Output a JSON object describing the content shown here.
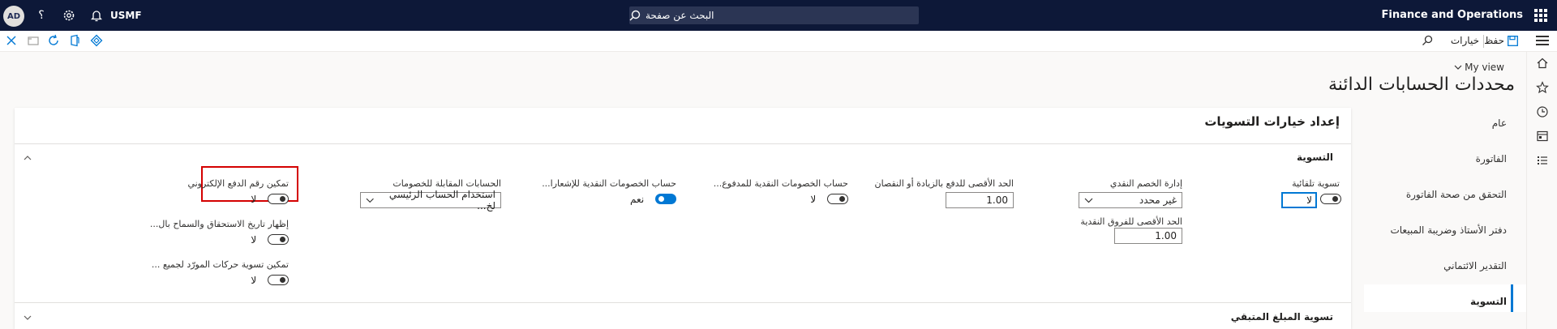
{
  "topbar": {
    "brand": "Finance and Operations",
    "search_placeholder": "البحث عن صفحة",
    "company": "USMF",
    "avatar": "AD",
    "help": "؟",
    "icons": [
      "waffle-icon",
      "search-icon",
      "bell-icon",
      "gear-icon",
      "help-icon"
    ]
  },
  "actionbar": {
    "save_label": "حفظ",
    "options_label": "خيارات",
    "icons": [
      "hamburger-icon",
      "save-icon",
      "search-icon",
      "close-icon",
      "delete-icon",
      "refresh-icon",
      "office-icon",
      "power-apps-icon"
    ]
  },
  "page": {
    "my_view": "My view",
    "title": "محددات الحسابات الدائنة"
  },
  "panel": {
    "title": "إعداد خيارات التسويات"
  },
  "tabs": {
    "items": [
      {
        "label": "عام"
      },
      {
        "label": "الفاتورة"
      },
      {
        "label": "التحقق من صحة الفاتورة"
      },
      {
        "label": "دفتر الأستاذ وضريبة المبيعات"
      },
      {
        "label": "التقدير الائتماني"
      },
      {
        "label": "التسوية"
      }
    ],
    "active_index": 5
  },
  "groups": {
    "settlement": "التسوية",
    "remaining": "تسوية المبلغ المتبقي"
  },
  "fields": {
    "auto_settle": {
      "label": "تسوية تلقائية",
      "value": "لا"
    },
    "cash_discount_admin": {
      "label": "إدارة الخصم النقدي",
      "value": "غير محدد"
    },
    "max_cash_diff": {
      "label": "الحد الأقصى للفروق النقدية",
      "value": "1.00"
    },
    "max_over_under": {
      "label": "الحد الأقصى للدفع بالزيادة أو النقصان",
      "value": "1.00"
    },
    "cash_discount_paid": {
      "label": "حساب الخصومات النقدية للمدفوع...",
      "value": "لا"
    },
    "cash_discount_notif": {
      "label": "حساب الخصومات النقدية للإشعارا...",
      "value": "نعم"
    },
    "offset_accounts": {
      "label": "الحسابات المقابلة للخصومات",
      "value": "استخدام الحساب الرئيسي لخ..."
    },
    "electronic_payment": {
      "label": "تمكين رقم الدفع الإلكتروني",
      "value": "لا"
    },
    "show_due_date": {
      "label": "إظهار تاريخ الاستحقاق والسماح بال...",
      "value": "لا"
    },
    "vendor_settlement": {
      "label": "تمكين تسوية حركات المورّد لجميع ...",
      "value": "لا"
    }
  }
}
